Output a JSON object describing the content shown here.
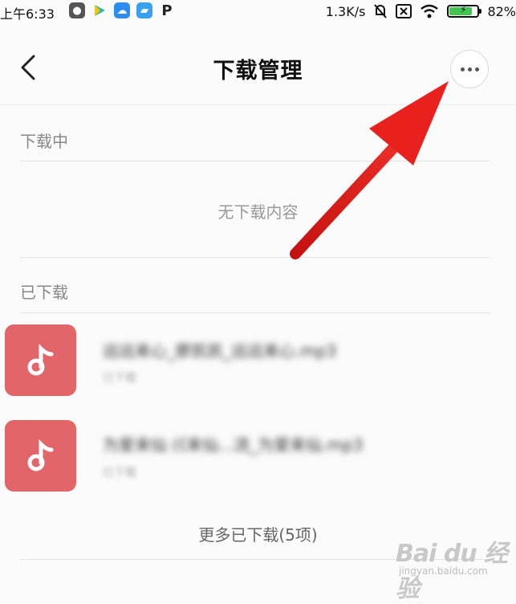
{
  "status_bar": {
    "time": "上午6:33",
    "network_speed": "1.3K/s",
    "battery": "82%",
    "battery_level": 0.82,
    "app_icons": [
      "wechat-icon",
      "play-icon",
      "cloud-icon",
      "file-icon",
      "p-app-icon"
    ]
  },
  "header": {
    "title": "下载管理"
  },
  "downloading": {
    "title": "下载中",
    "empty_text": "无下载内容"
  },
  "downloaded": {
    "title": "已下载",
    "items": [
      {
        "name": "远远来心_廖凯凯_远远来心.mp3",
        "status": "已下载"
      },
      {
        "name": "为爱来仙 (《来仙...流_为爱来仙.mp3",
        "status": "已下载"
      }
    ],
    "more_label": "更多已下载(5项)"
  },
  "watermark": {
    "logo": "Bai du 经验",
    "site": "jingyan.baidu.com"
  },
  "colors": {
    "music_icon_bg": "#e2656a",
    "annotation_arrow": "#e8201e"
  }
}
